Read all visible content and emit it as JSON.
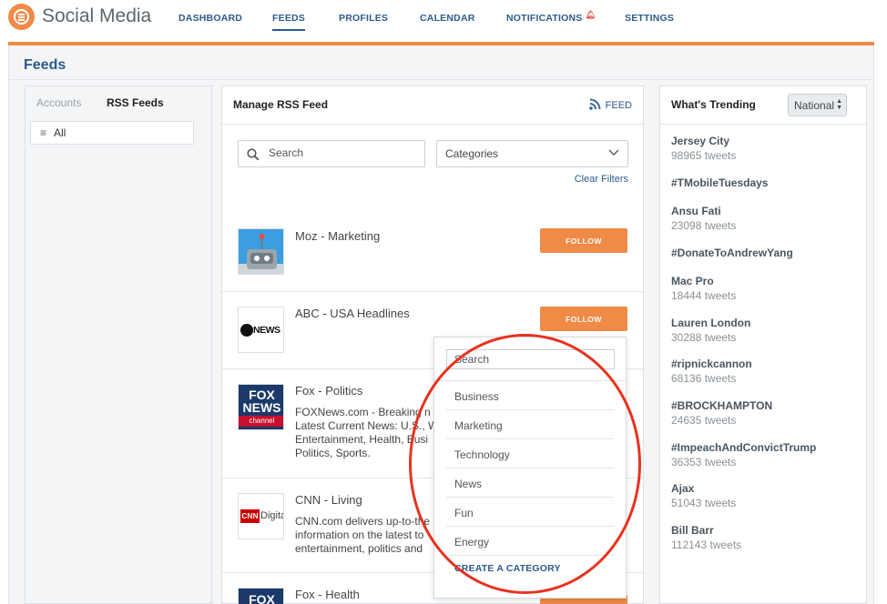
{
  "app": {
    "title": "Social Media"
  },
  "nav": [
    {
      "label": "DASHBOARD",
      "active": false
    },
    {
      "label": "FEEDS",
      "active": true
    },
    {
      "label": "PROFILES",
      "active": false
    },
    {
      "label": "CALENDAR",
      "active": false
    },
    {
      "label": "NOTIFICATIONS",
      "active": false
    },
    {
      "label": "SETTINGS",
      "active": false
    }
  ],
  "page": {
    "title": "Feeds"
  },
  "sidebar": {
    "tabs": [
      {
        "label": "Accounts"
      },
      {
        "label": "RSS Feeds"
      }
    ],
    "items": [
      {
        "label": "All"
      }
    ]
  },
  "manage": {
    "title": "Manage RSS Feed",
    "feed_button": "FEED",
    "search_placeholder": "Search",
    "categories_label": "Categories",
    "clear_filters": "Clear Filters",
    "follow_label": "FOLLOW",
    "feeds": [
      {
        "name": "Moz - Marketing",
        "description": ""
      },
      {
        "name": "ABC - USA Headlines",
        "description": "",
        "logo_text": "NEWS"
      },
      {
        "name": "Fox - Politics",
        "description": "FOXNews.com - Breaking n\nLatest Current News: U.S., W\nEntertainment, Health, Busi\nPolitics, Sports.",
        "logo_text": [
          "FOX",
          "NEWS",
          "channel"
        ]
      },
      {
        "name": "CNN - Living",
        "description": "CNN.com delivers up-to-the\ninformation on the latest to\nentertainment, politics and",
        "logo_text": [
          "CNN",
          "Digital"
        ]
      },
      {
        "name": "Fox - Health",
        "description": "",
        "logo_text": "FOX"
      }
    ]
  },
  "category_dropdown": {
    "search_placeholder": "Search",
    "options": [
      "Business",
      "Marketing",
      "Technology",
      "News",
      "Fun",
      "Energy"
    ],
    "create_label": "CREATE A CATEGORY"
  },
  "trending": {
    "title": "What's Trending",
    "region": "National",
    "items": [
      {
        "name": "Jersey City",
        "count": "98965 tweets"
      },
      {
        "name": "#TMobileTuesdays",
        "count": ""
      },
      {
        "name": "Ansu Fati",
        "count": "23098 tweets"
      },
      {
        "name": "#DonateToAndrewYang",
        "count": ""
      },
      {
        "name": "Mac Pro",
        "count": "18444 tweets"
      },
      {
        "name": "Lauren London",
        "count": "30288 tweets"
      },
      {
        "name": "#ripnickcannon",
        "count": "68136 tweets"
      },
      {
        "name": "#BROCKHAMPTON",
        "count": "24635 tweets"
      },
      {
        "name": "#ImpeachAndConvictTrump",
        "count": "36353 tweets"
      },
      {
        "name": "Ajax",
        "count": "51043 tweets"
      },
      {
        "name": "Bill Barr",
        "count": "112143 tweets"
      }
    ]
  },
  "colors": {
    "accent": "#f08a47",
    "link": "#2c5a8c",
    "annotation": "#e8321e"
  }
}
